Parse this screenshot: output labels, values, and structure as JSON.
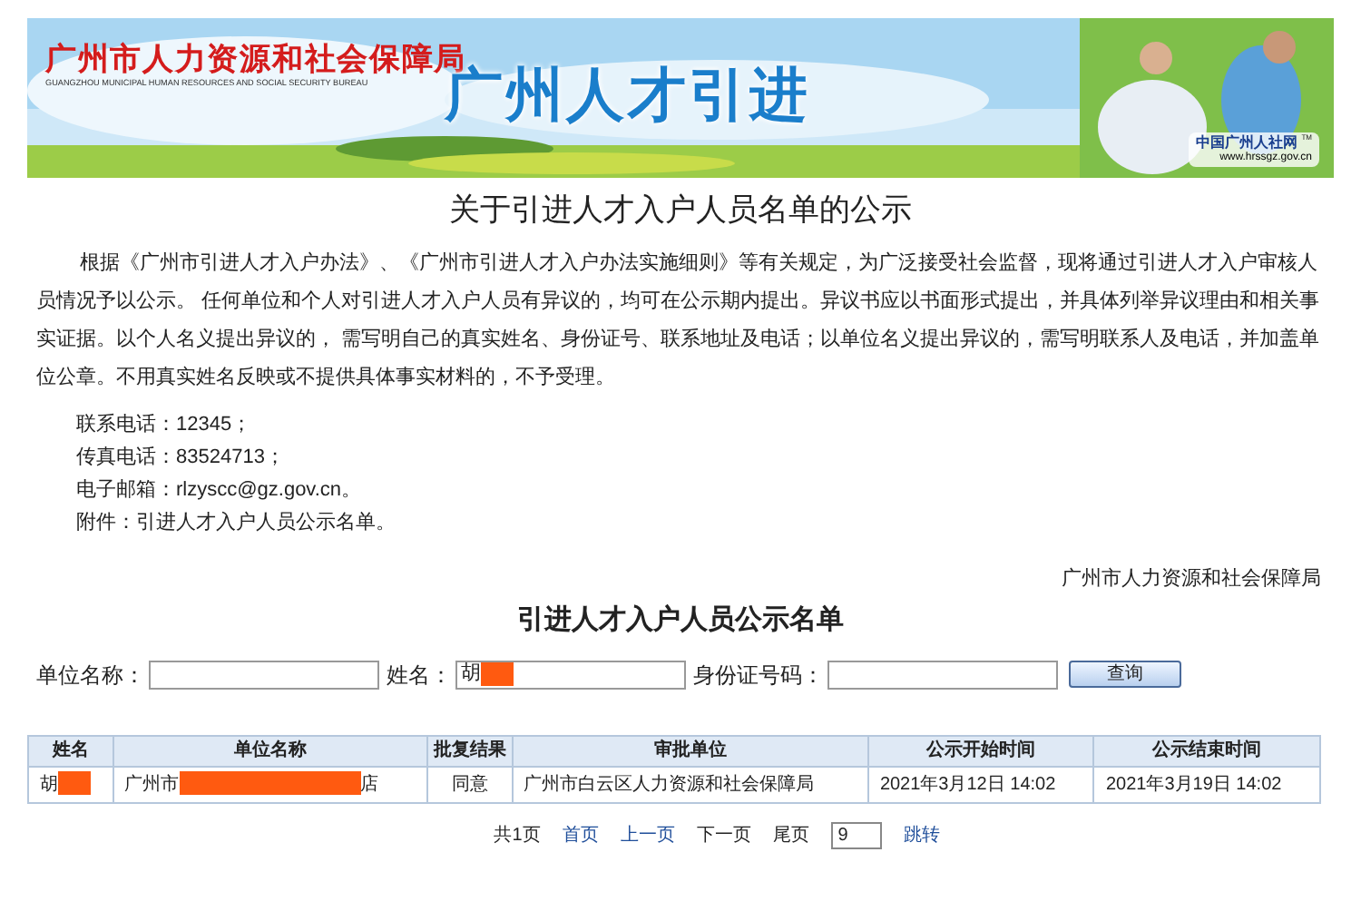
{
  "banner": {
    "agency": "广州市人力资源和社会保障局",
    "agency_en": "GUANGZHOU MUNICIPAL HUMAN RESOURCES AND SOCIAL SECURITY BUREAU",
    "headline": "广州人才引进",
    "logo_text": "中国广州人社网",
    "logo_mark": "TM",
    "url": "www.hrssgz.gov.cn"
  },
  "title": "关于引进人才入户人员名单的公示",
  "paragraph": "根据《广州市引进人才入户办法》、《广州市引进人才入户办法实施细则》等有关规定，为广泛接受社会监督，现将通过引进人才入户审核人员情况予以公示。 任何单位和个人对引进人才入户人员有异议的，均可在公示期内提出。异议书应以书面形式提出，并具体列举异议理由和相关事实证据。以个人名义提出异议的， 需写明自己的真实姓名、身份证号、联系地址及电话；以单位名义提出异议的，需写明联系人及电话，并加盖单位公章。不用真实姓名反映或不提供具体事实材料的，不予受理。",
  "contacts": [
    "联系电话：12345；",
    "传真电话：83524713；",
    "电子邮箱：rlzyscc@gz.gov.cn。",
    "附件：引进人才入户人员公示名单。"
  ],
  "issuer": "广州市人力资源和社会保障局",
  "list_title": "引进人才入户人员公示名单",
  "search": {
    "fields": [
      {
        "label": "单位名称：",
        "redacted": false
      },
      {
        "label": "姓名：",
        "value": "胡",
        "redacted": true
      },
      {
        "label": "身份证号码：",
        "redacted": false
      }
    ],
    "button": "查询"
  },
  "table": {
    "columns": [
      "姓名",
      "单位名称",
      "批复结果",
      "审批单位",
      "公示开始时间",
      "公示结束时间"
    ],
    "rows": [
      {
        "cells": [
          {
            "before": "胡",
            "redacted": true
          },
          {
            "before": "广州市",
            "after": "店",
            "redacted": true
          },
          {
            "before": "同意",
            "redacted": false
          },
          {
            "before": "广州市白云区人力资源和社会保障局",
            "redacted": false
          },
          {
            "before": "2021年3月12日 14:02",
            "redacted": false
          },
          {
            "before": "2021年3月19日 14:02",
            "redacted": false
          }
        ]
      }
    ]
  },
  "pagination": {
    "items": [
      {
        "kind": "text",
        "label": "共1页"
      },
      {
        "kind": "link",
        "label": "首页"
      },
      {
        "kind": "link",
        "label": "上一页"
      },
      {
        "kind": "text",
        "label": "下一页"
      },
      {
        "kind": "text",
        "label": "尾页"
      },
      {
        "kind": "input",
        "label": "9"
      },
      {
        "kind": "link",
        "label": "跳转"
      }
    ]
  }
}
